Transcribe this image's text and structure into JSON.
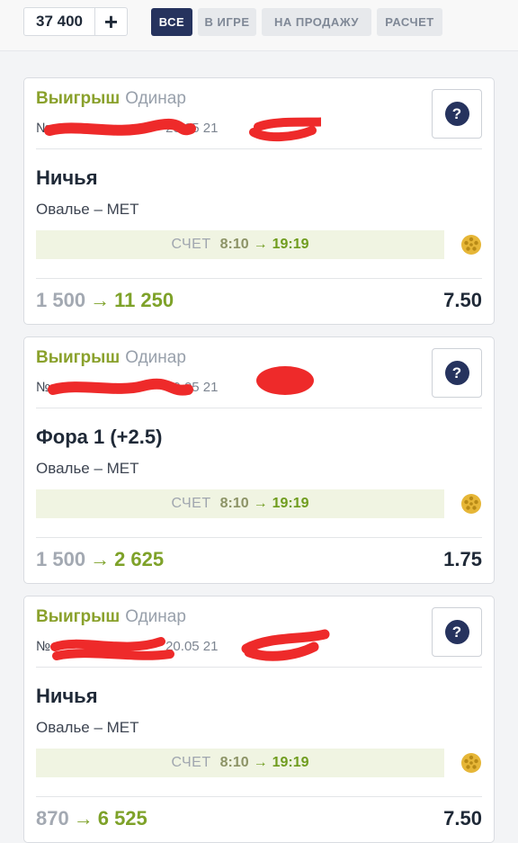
{
  "header": {
    "balance": "37 400",
    "add_label": "+",
    "tabs": [
      {
        "label": "ВСЕ",
        "active": true
      },
      {
        "label": "В ИГРЕ",
        "active": false
      },
      {
        "label": "НА ПРОДАЖУ",
        "active": false
      },
      {
        "label": "РАСЧЕТ",
        "active": false
      }
    ]
  },
  "bets": [
    {
      "status": "Выигрыш",
      "type": "Одинар",
      "number_prefix": "№",
      "date": "20.05 21",
      "help": "?",
      "outcome": "Ничья",
      "event": "Овалье – МЕТ",
      "score_label": "СЧЕТ",
      "score_from": "8:10",
      "score_to": "19:19",
      "stake": "1 500",
      "payout": "11 250",
      "odds": "7.50"
    },
    {
      "status": "Выигрыш",
      "type": "Одинар",
      "number_prefix": "№",
      "date": "20.05 21",
      "help": "?",
      "outcome": "Фора 1 (+2.5)",
      "event": "Овалье – МЕТ",
      "score_label": "СЧЕТ",
      "score_from": "8:10",
      "score_to": "19:19",
      "stake": "1 500",
      "payout": "2 625",
      "odds": "1.75"
    },
    {
      "status": "Выигрыш",
      "type": "Одинар",
      "number_prefix": "№",
      "date": "20.05 21",
      "help": "?",
      "outcome": "Ничья",
      "event": "Овалье – МЕТ",
      "score_label": "СЧЕТ",
      "score_from": "8:10",
      "score_to": "19:19",
      "stake": "870",
      "payout": "6 525",
      "odds": "7.50"
    }
  ],
  "icons": {
    "arrow": "→",
    "sport": "handball-icon"
  },
  "colors": {
    "accent_green": "#7ea229",
    "navy": "#26335e",
    "redaction": "#ee2a2a"
  }
}
